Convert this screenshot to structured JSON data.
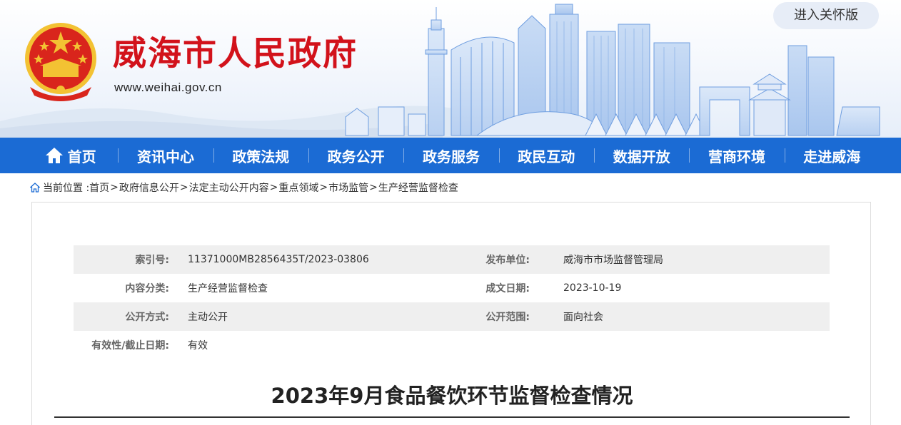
{
  "header": {
    "title": "威海市人民政府",
    "url": "www.weihai.gov.cn",
    "care_button": "进入关怀版",
    "emblem": "national-emblem",
    "brand_red": "#d2121b"
  },
  "nav": {
    "color": "#1b6bd4",
    "items": [
      {
        "label": "首页",
        "icon": "home-icon"
      },
      {
        "label": "资讯中心"
      },
      {
        "label": "政策法规"
      },
      {
        "label": "政务公开"
      },
      {
        "label": "政务服务"
      },
      {
        "label": "政民互动"
      },
      {
        "label": "数据开放"
      },
      {
        "label": "营商环境"
      },
      {
        "label": "走进威海"
      }
    ]
  },
  "breadcrumb": {
    "icon": "home-icon",
    "prefix": "当前位置 :",
    "items": [
      "首页",
      "政府信息公开",
      "法定主动公开内容",
      "重点领域",
      "市场监管",
      "生产经营监督检查"
    ],
    "separator": ">"
  },
  "meta": {
    "rows": [
      {
        "label1": "索引号:",
        "value1": "11371000MB2856435T/2023-03806",
        "label2": "发布单位:",
        "value2": "威海市市场监督管理局"
      },
      {
        "label1": "内容分类:",
        "value1": "生产经营监督检查",
        "label2": "成文日期:",
        "value2": "2023-10-19"
      },
      {
        "label1": "公开方式:",
        "value1": "主动公开",
        "label2": "公开范围:",
        "value2": "面向社会"
      },
      {
        "label1": "有效性/截止日期:",
        "value1": "有效",
        "label2": "",
        "value2": ""
      }
    ]
  },
  "article": {
    "title": "2023年9月食品餐饮环节监督检查情况"
  }
}
